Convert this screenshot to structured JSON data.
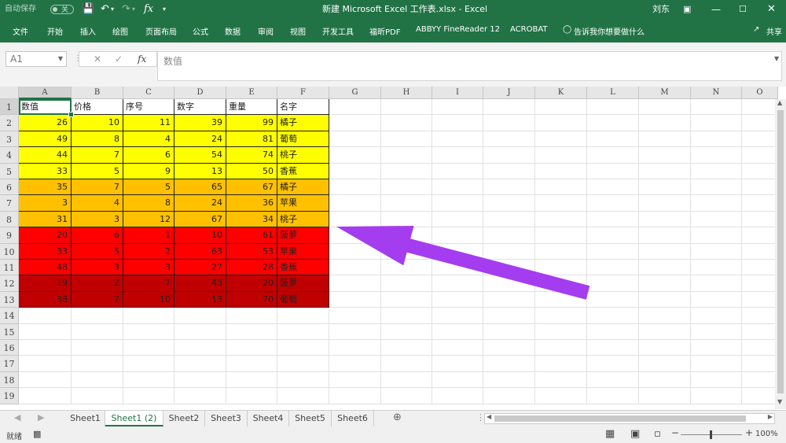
{
  "window": {
    "autosave_label": "自动保存",
    "autosave_state": "关",
    "title": "新建 Microsoft Excel 工作表.xlsx  -  Excel",
    "user": "刘东"
  },
  "ribbon": {
    "tabs": [
      "文件",
      "开始",
      "插入",
      "绘图",
      "页面布局",
      "公式",
      "数据",
      "审阅",
      "视图",
      "开发工具",
      "福昕PDF",
      "ABBYY FineReader 12",
      "ACROBAT"
    ],
    "tell_me": "告诉我你想要做什么",
    "share": "共享"
  },
  "formula_bar": {
    "name_box": "A1",
    "value": "数值"
  },
  "sheet": {
    "columns": [
      "A",
      "B",
      "C",
      "D",
      "E",
      "F",
      "G",
      "H",
      "I",
      "J",
      "K",
      "L",
      "M",
      "N",
      "O"
    ],
    "rows": [
      "1",
      "2",
      "3",
      "4",
      "5",
      "6",
      "7",
      "8",
      "9",
      "10",
      "11",
      "12",
      "13",
      "14",
      "15",
      "16",
      "17",
      "18",
      "19"
    ],
    "header": [
      "数值",
      "价格",
      "序号",
      "数字",
      "重量",
      "名字"
    ],
    "data": [
      [
        "26",
        "10",
        "11",
        "39",
        "99",
        "橘子"
      ],
      [
        "49",
        "8",
        "4",
        "24",
        "81",
        "葡萄"
      ],
      [
        "44",
        "7",
        "6",
        "54",
        "74",
        "桃子"
      ],
      [
        "33",
        "5",
        "9",
        "13",
        "50",
        "香蕉"
      ],
      [
        "35",
        "7",
        "5",
        "65",
        "67",
        "橘子"
      ],
      [
        "3",
        "4",
        "8",
        "24",
        "36",
        "苹果"
      ],
      [
        "31",
        "3",
        "12",
        "67",
        "34",
        "桃子"
      ],
      [
        "20",
        "6",
        "1",
        "10",
        "61",
        "菠萝"
      ],
      [
        "33",
        "5",
        "2",
        "63",
        "53",
        "苹果"
      ],
      [
        "48",
        "3",
        "3",
        "27",
        "28",
        "香蕉"
      ],
      [
        "19",
        "2",
        "7",
        "43",
        "20",
        "菠萝"
      ],
      [
        "38",
        "7",
        "10",
        "13",
        "70",
        "葡萄"
      ]
    ],
    "row_fill_colors": [
      "#FFFF00",
      "#FFFF00",
      "#FFFF00",
      "#FFFF00",
      "#FFC000",
      "#FFC000",
      "#FFC000",
      "#FF0000",
      "#FF0000",
      "#FF0000",
      "#C00000",
      "#C00000"
    ],
    "annotation_arrow_color": "#A43CF0"
  },
  "tabs": [
    "Sheet1",
    "Sheet1 (2)",
    "Sheet2",
    "Sheet3",
    "Sheet4",
    "Sheet5",
    "Sheet6"
  ],
  "active_tab": "Sheet1 (2)",
  "status": {
    "mode": "就绪",
    "zoom": "100%"
  },
  "colors": {
    "accent": "#217346"
  }
}
